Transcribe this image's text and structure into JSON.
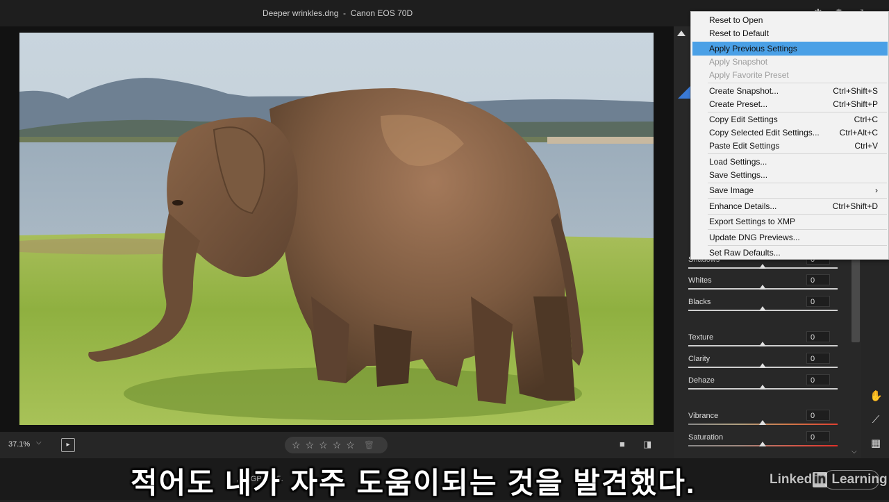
{
  "titlebar": {
    "title": "Deeper wrinkles.dng  -  Canon EOS 70D"
  },
  "bottombar": {
    "zoom": "37.1%",
    "stars": [
      "☆",
      "☆",
      "☆",
      "☆",
      "☆"
    ],
    "info_text": ", ok   GP   8   (15."
  },
  "panel": {
    "sliders": [
      {
        "label": "Shadows",
        "value": "0"
      },
      {
        "label": "Whites",
        "value": "0"
      },
      {
        "label": "Blacks",
        "value": "0"
      },
      {
        "label": "Texture",
        "value": "0"
      },
      {
        "label": "Clarity",
        "value": "0"
      },
      {
        "label": "Dehaze",
        "value": "0"
      },
      {
        "label": "Vibrance",
        "value": "0"
      },
      {
        "label": "Saturation",
        "value": "0"
      }
    ]
  },
  "menu": {
    "items": [
      {
        "label": "Reset to Open",
        "shortcut": ""
      },
      {
        "label": "Reset to Default",
        "shortcut": ""
      },
      {
        "label": "Apply Previous Settings",
        "shortcut": ""
      },
      {
        "label": "Apply Snapshot",
        "shortcut": ""
      },
      {
        "label": "Apply Favorite Preset",
        "shortcut": ""
      },
      {
        "label": "Create Snapshot...",
        "shortcut": "Ctrl+Shift+S"
      },
      {
        "label": "Create Preset...",
        "shortcut": "Ctrl+Shift+P"
      },
      {
        "label": "Copy Edit Settings",
        "shortcut": "Ctrl+C"
      },
      {
        "label": "Copy Selected Edit Settings...",
        "shortcut": "Ctrl+Alt+C"
      },
      {
        "label": "Paste Edit Settings",
        "shortcut": "Ctrl+V"
      },
      {
        "label": "Load Settings...",
        "shortcut": ""
      },
      {
        "label": "Save Settings...",
        "shortcut": ""
      },
      {
        "label": "Save Image",
        "shortcut": "›"
      },
      {
        "label": "Enhance Details...",
        "shortcut": "Ctrl+Shift+D"
      },
      {
        "label": "Export Settings to XMP",
        "shortcut": ""
      },
      {
        "label": "Update DNG Previews...",
        "shortcut": ""
      },
      {
        "label": "Set Raw Defaults...",
        "shortcut": ""
      }
    ]
  },
  "overlay": {
    "subtitle": "적어도 내가 자주 도움이되는 것을 발견했다.",
    "watermark_left": "Linked",
    "watermark_in": "in",
    "watermark_right": " Learning"
  }
}
